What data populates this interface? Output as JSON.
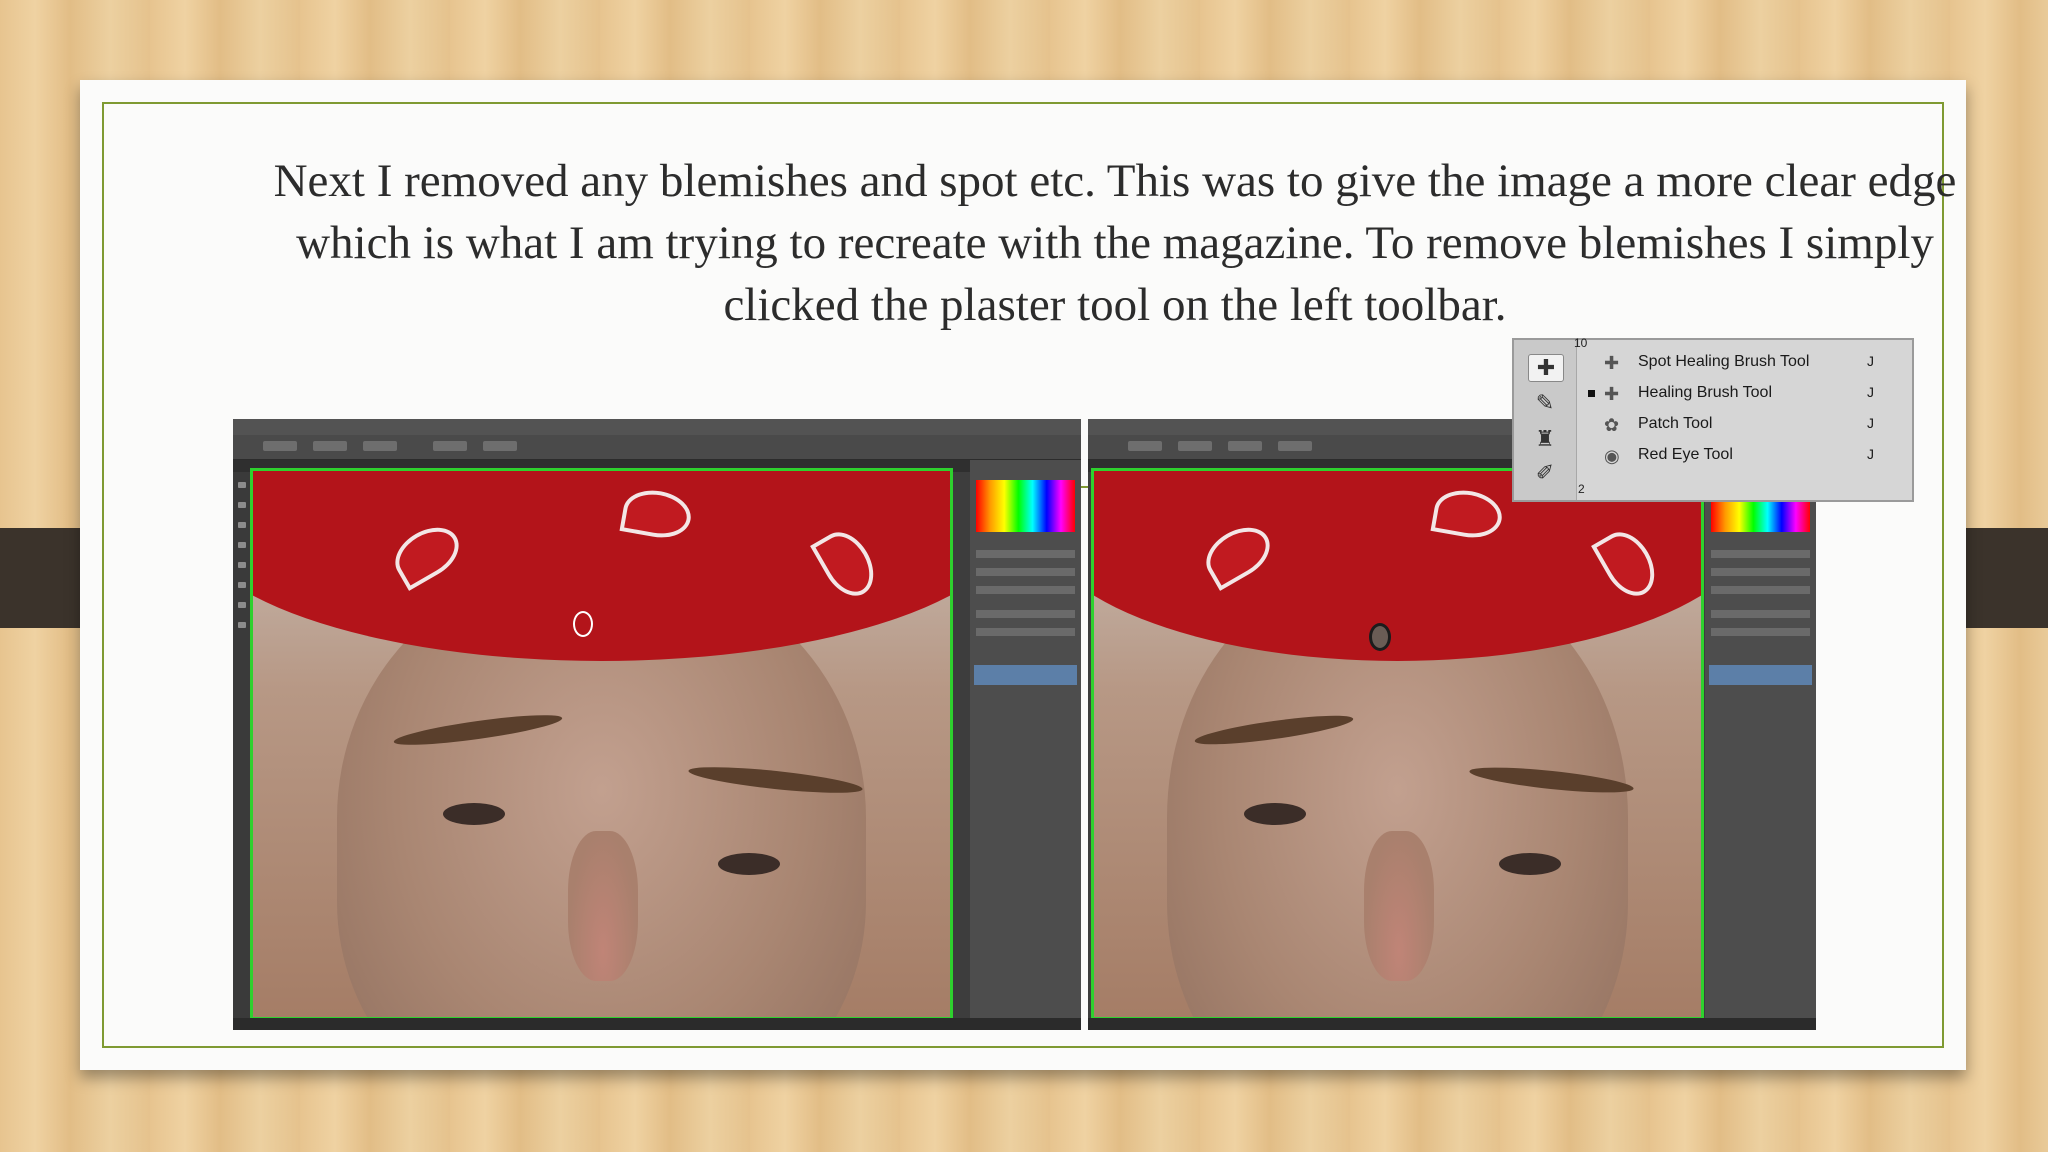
{
  "slide": {
    "text": "Next I removed any blemishes and spot etc. This was to give the image a more clear edge which is what I am trying to recreate with the magazine. To remove blemishes I simply clicked the plaster tool on the left toolbar."
  },
  "screenshots": [
    {
      "name": "before-blemish-removal"
    },
    {
      "name": "after-blemish-removal"
    }
  ],
  "tool_popup": {
    "items": [
      {
        "label": "Spot Healing Brush Tool",
        "shortcut": "J",
        "icon": "spot-healing-brush-icon"
      },
      {
        "label": "Healing Brush Tool",
        "shortcut": "J",
        "icon": "healing-brush-icon",
        "selected": true
      },
      {
        "label": "Patch Tool",
        "shortcut": "J",
        "icon": "patch-icon"
      },
      {
        "label": "Red Eye Tool",
        "shortcut": "J",
        "icon": "red-eye-icon"
      }
    ],
    "side_numbers": [
      "10",
      "2"
    ]
  },
  "colors": {
    "frame_green": "#7f9a32",
    "canvas_border": "#2ed12e",
    "bandana_red": "#b3141a"
  }
}
